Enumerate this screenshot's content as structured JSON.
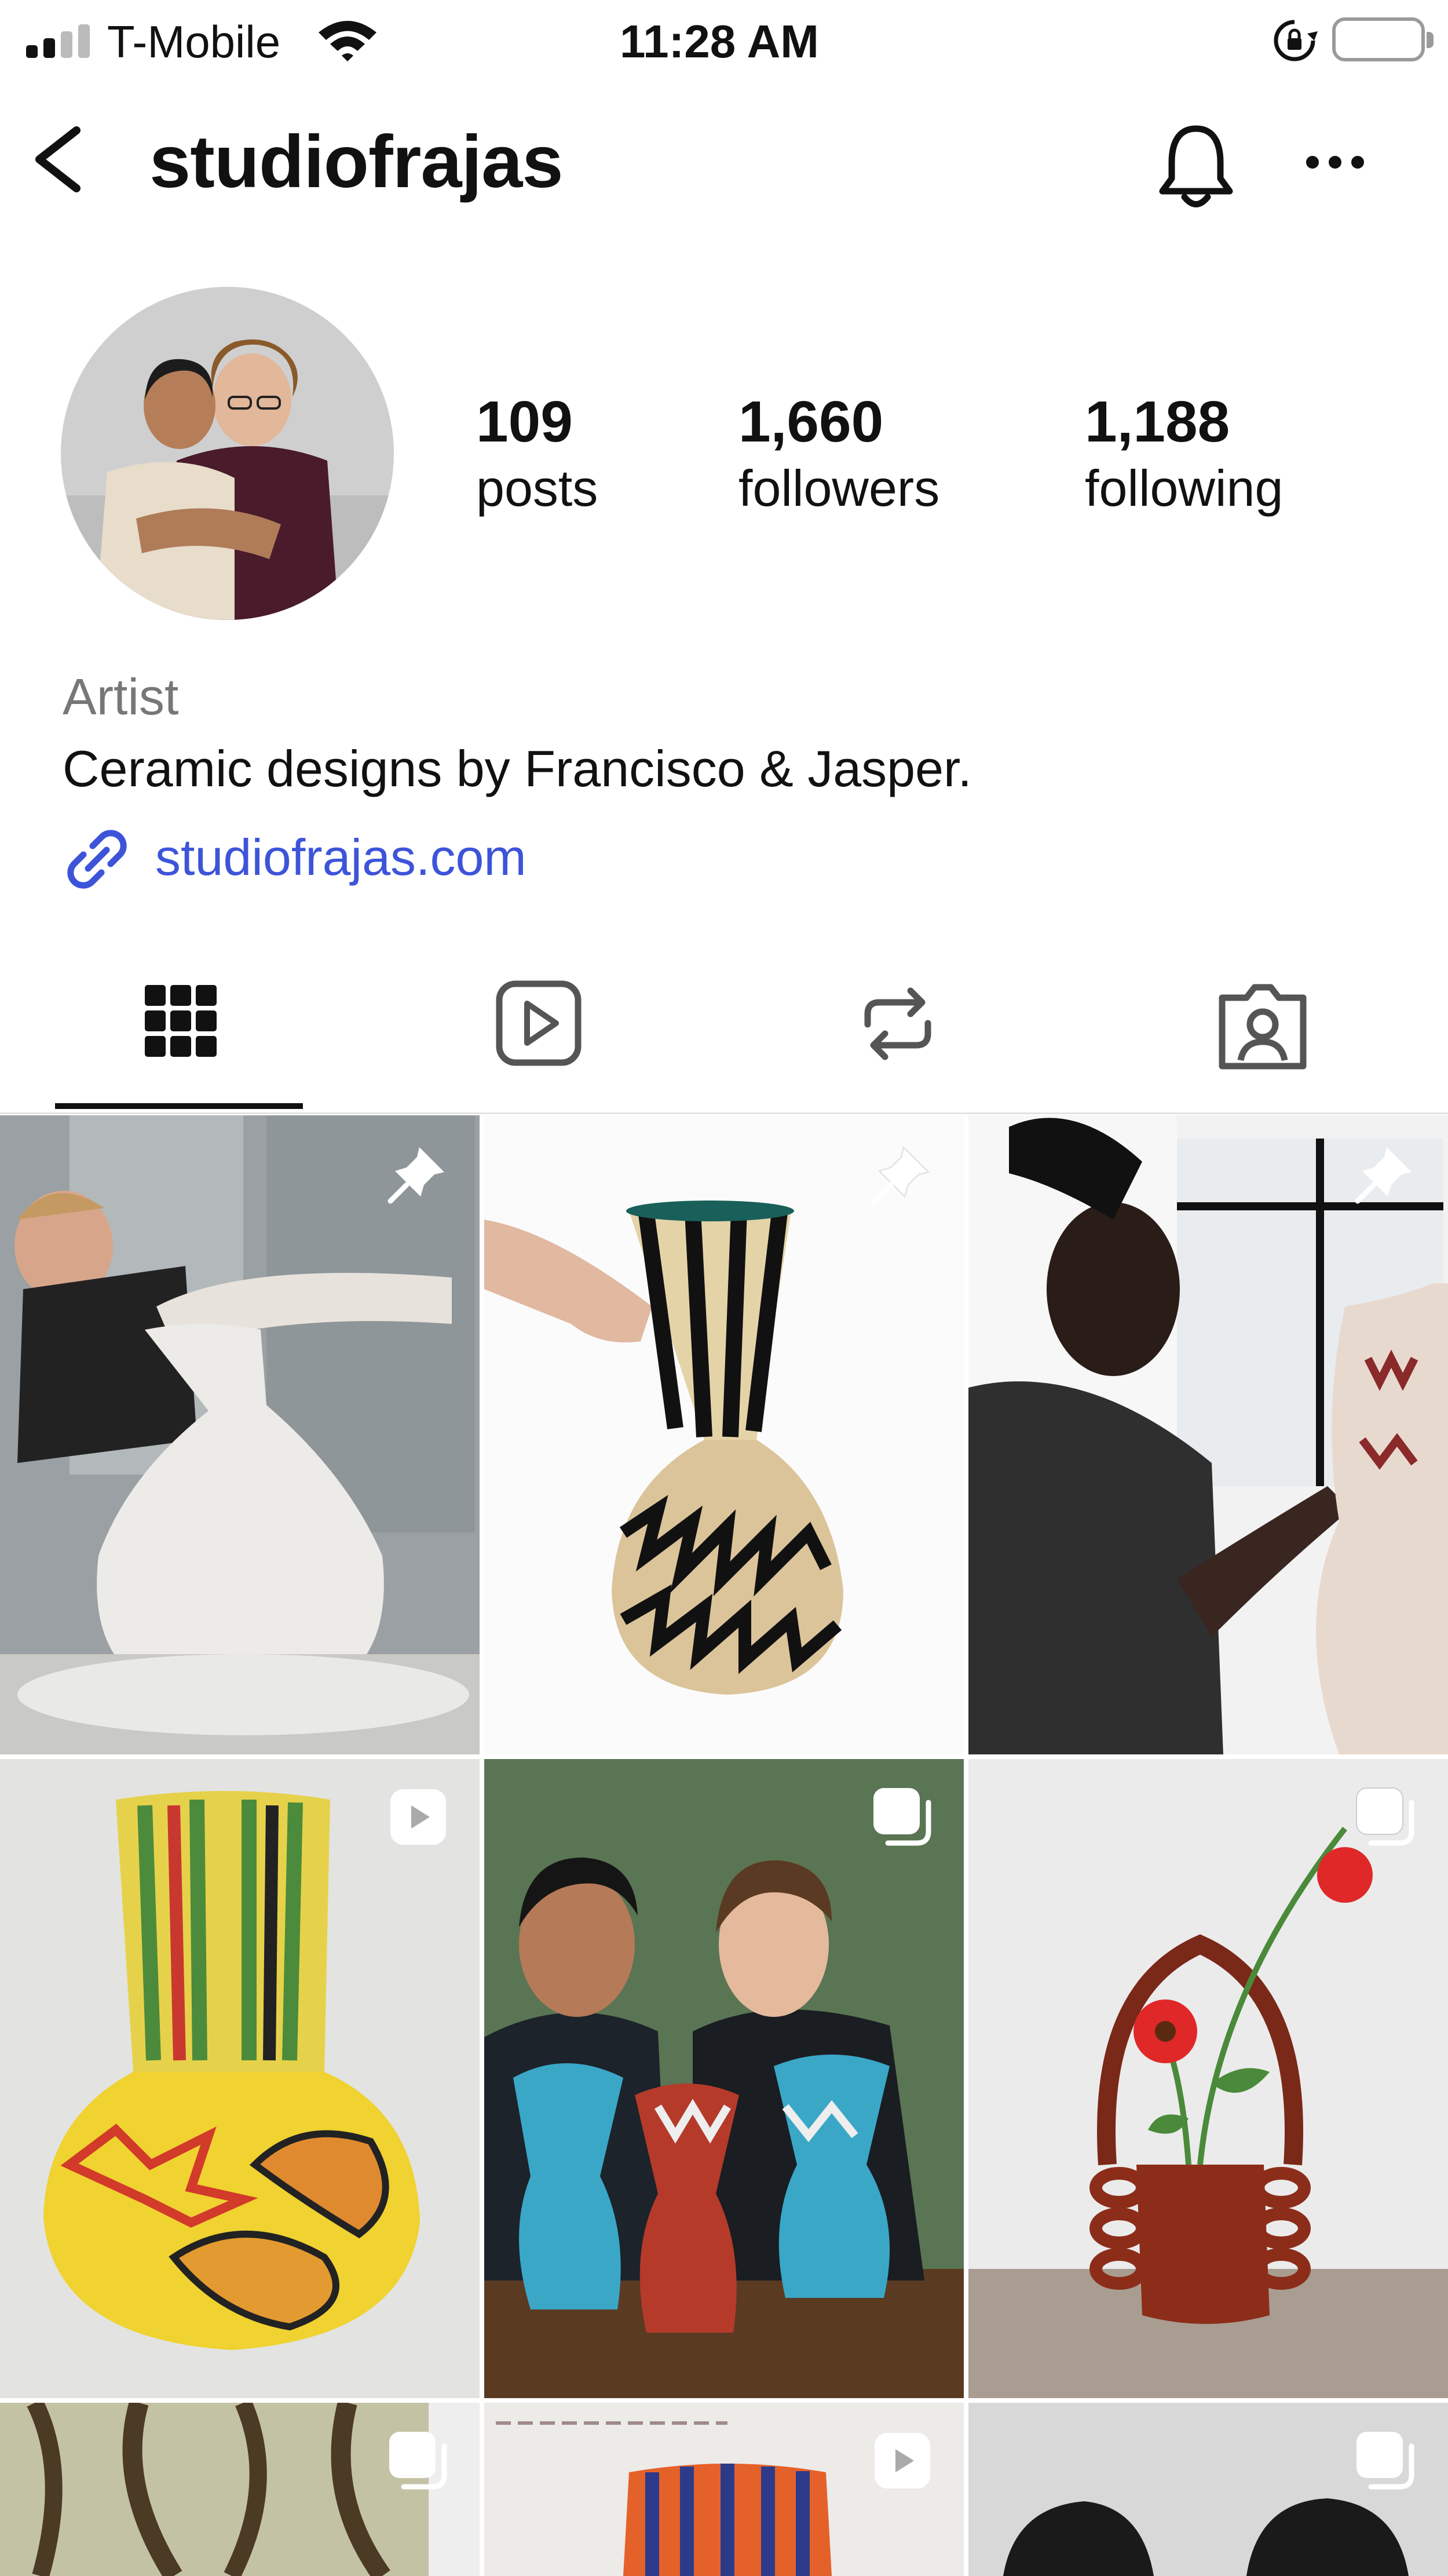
{
  "status_bar": {
    "carrier": "T-Mobile",
    "time": "11:28 AM"
  },
  "header": {
    "username": "studiofrajas"
  },
  "profile": {
    "stats": [
      {
        "number": "109",
        "label": "posts"
      },
      {
        "number": "1,660",
        "label": "followers"
      },
      {
        "number": "1,188",
        "label": "following"
      }
    ],
    "category": "Artist",
    "bio": "Ceramic designs by Francisco & Jasper.",
    "link": "studiofrajas.com"
  },
  "tabs": [
    {
      "name": "posts-grid",
      "icon": "grid-icon",
      "active": true
    },
    {
      "name": "reels",
      "icon": "reels-icon",
      "active": false
    },
    {
      "name": "reposts",
      "icon": "repost-icon",
      "active": false
    },
    {
      "name": "tagged",
      "icon": "tagged-person-icon",
      "active": false
    }
  ],
  "grid": [
    {
      "description": "potter throwing a white vase on a wheel",
      "badge": "pin-icon"
    },
    {
      "description": "striped black and cream vase with zigzag base",
      "badge": "pin-icon"
    },
    {
      "description": "man painting a ceramic vase",
      "badge": "pin-icon"
    },
    {
      "description": "colorful yellow patterned vase",
      "badge": "reel-icon"
    },
    {
      "description": "two men smiling with three painted vases",
      "badge": "carousel-icon"
    },
    {
      "description": "red loop-handled vase with red flowers",
      "badge": "carousel-icon"
    },
    {
      "description": "green glazed ceramic close-up",
      "badge": "carousel-icon"
    },
    {
      "description": "vase sketch on paper",
      "badge": "reel-icon"
    },
    {
      "description": "black and white portrait",
      "badge": "carousel-icon"
    }
  ],
  "colors": {
    "text": "#111111",
    "secondary_text": "#777777",
    "link": "#3d54d9",
    "divider": "#e2e2e2"
  }
}
